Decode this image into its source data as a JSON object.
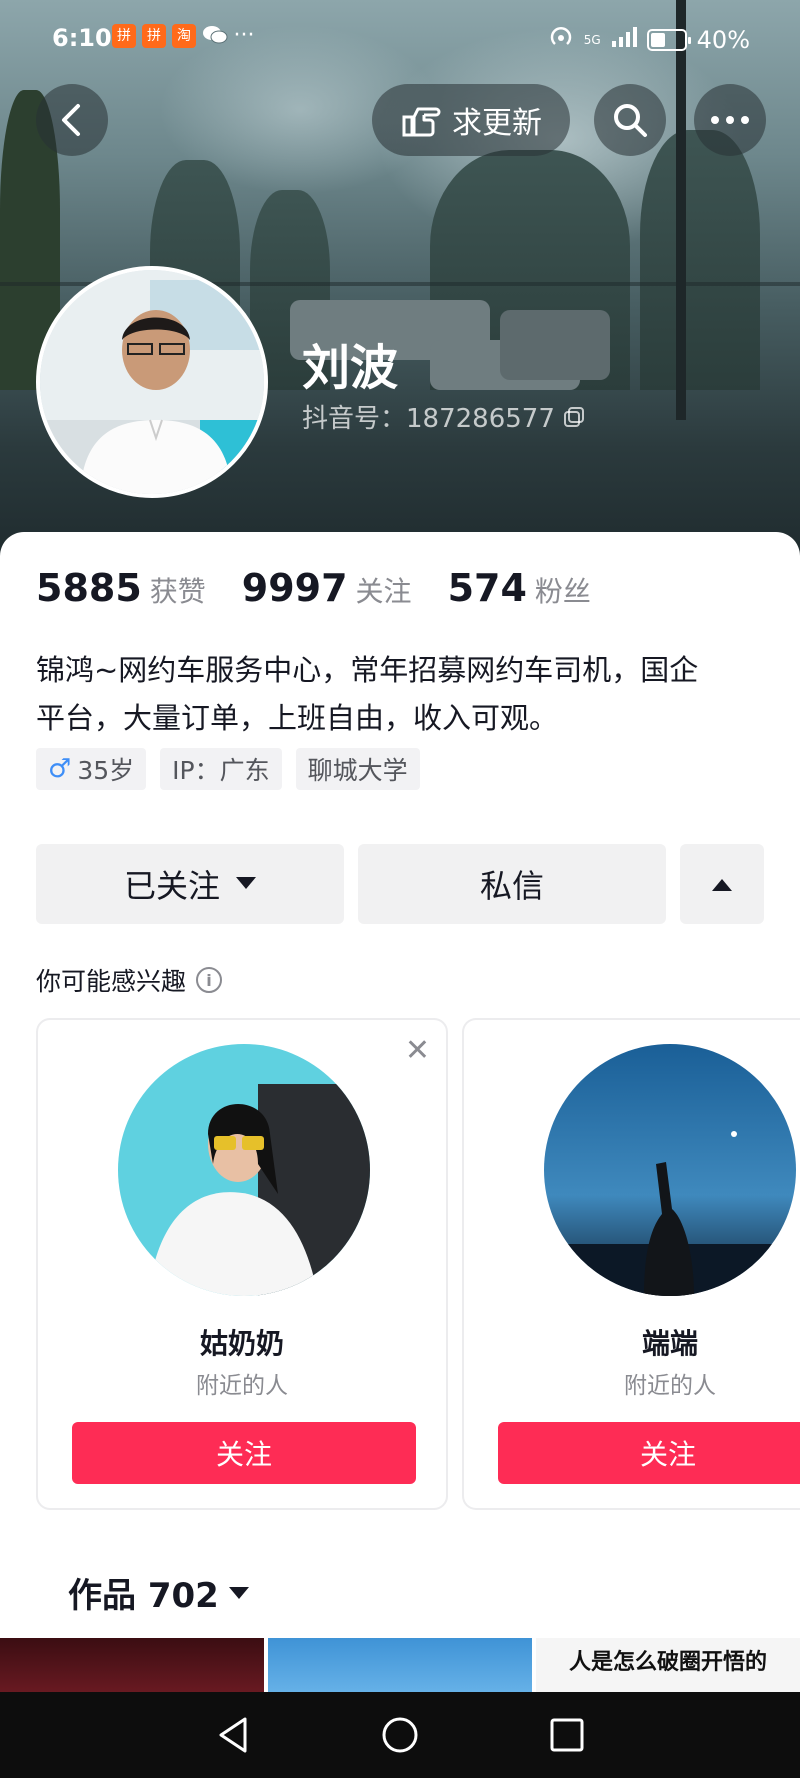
{
  "status_bar": {
    "time": "6:10",
    "app_icons": [
      "拼",
      "拼",
      "淘"
    ],
    "more": "···",
    "network": "5G",
    "battery": "40%"
  },
  "header": {
    "update_button_label": "求更新"
  },
  "profile": {
    "name": "刘波",
    "douyin_id": "抖音号：187286577",
    "stats": [
      {
        "value": "5885",
        "label": "获赞"
      },
      {
        "value": "9997",
        "label": "关注"
      },
      {
        "value": "574",
        "label": "粉丝"
      }
    ],
    "bio_line1": "锦鸿~网约车服务中心，常年招募网约车司机，国企",
    "bio_line2": "平台，大量订单，上班自由，收入可观。",
    "tags": {
      "age": "35岁",
      "ip": "IP：广东",
      "school": "聊城大学"
    }
  },
  "actions": {
    "followed_label": "已关注",
    "message_label": "私信"
  },
  "suggestions": {
    "title": "你可能感兴趣",
    "cards": [
      {
        "name": "姑奶奶",
        "subtitle": "附近的人",
        "follow_label": "关注"
      },
      {
        "name": "端端",
        "subtitle": "附近的人",
        "follow_label": "关注"
      }
    ]
  },
  "works": {
    "label": "作品 702",
    "thumb3_caption": "人是怎么破圈开悟的"
  },
  "colors": {
    "accent": "#fe2c55",
    "text": "#161823",
    "muted": "#8a8b91"
  }
}
